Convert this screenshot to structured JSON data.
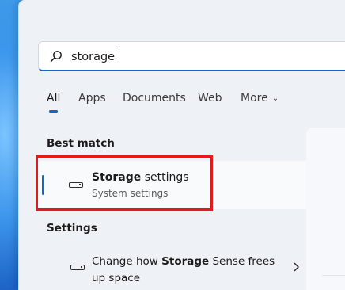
{
  "search": {
    "query": "storage"
  },
  "tabs": [
    {
      "label": "All",
      "active": true
    },
    {
      "label": "Apps"
    },
    {
      "label": "Documents"
    },
    {
      "label": "Web"
    },
    {
      "label": "More"
    }
  ],
  "best_match": {
    "heading": "Best match",
    "title_bold": "Storage",
    "title_rest": " settings",
    "subtitle": "System settings",
    "icon": "drive-icon"
  },
  "settings": {
    "heading": "Settings",
    "items": [
      {
        "pre": "Change how ",
        "bold": "Storage",
        "post": " Sense frees up space",
        "icon": "drive-icon"
      }
    ]
  },
  "colors": {
    "accent": "#1267c7",
    "highlight": "#e3191c"
  }
}
